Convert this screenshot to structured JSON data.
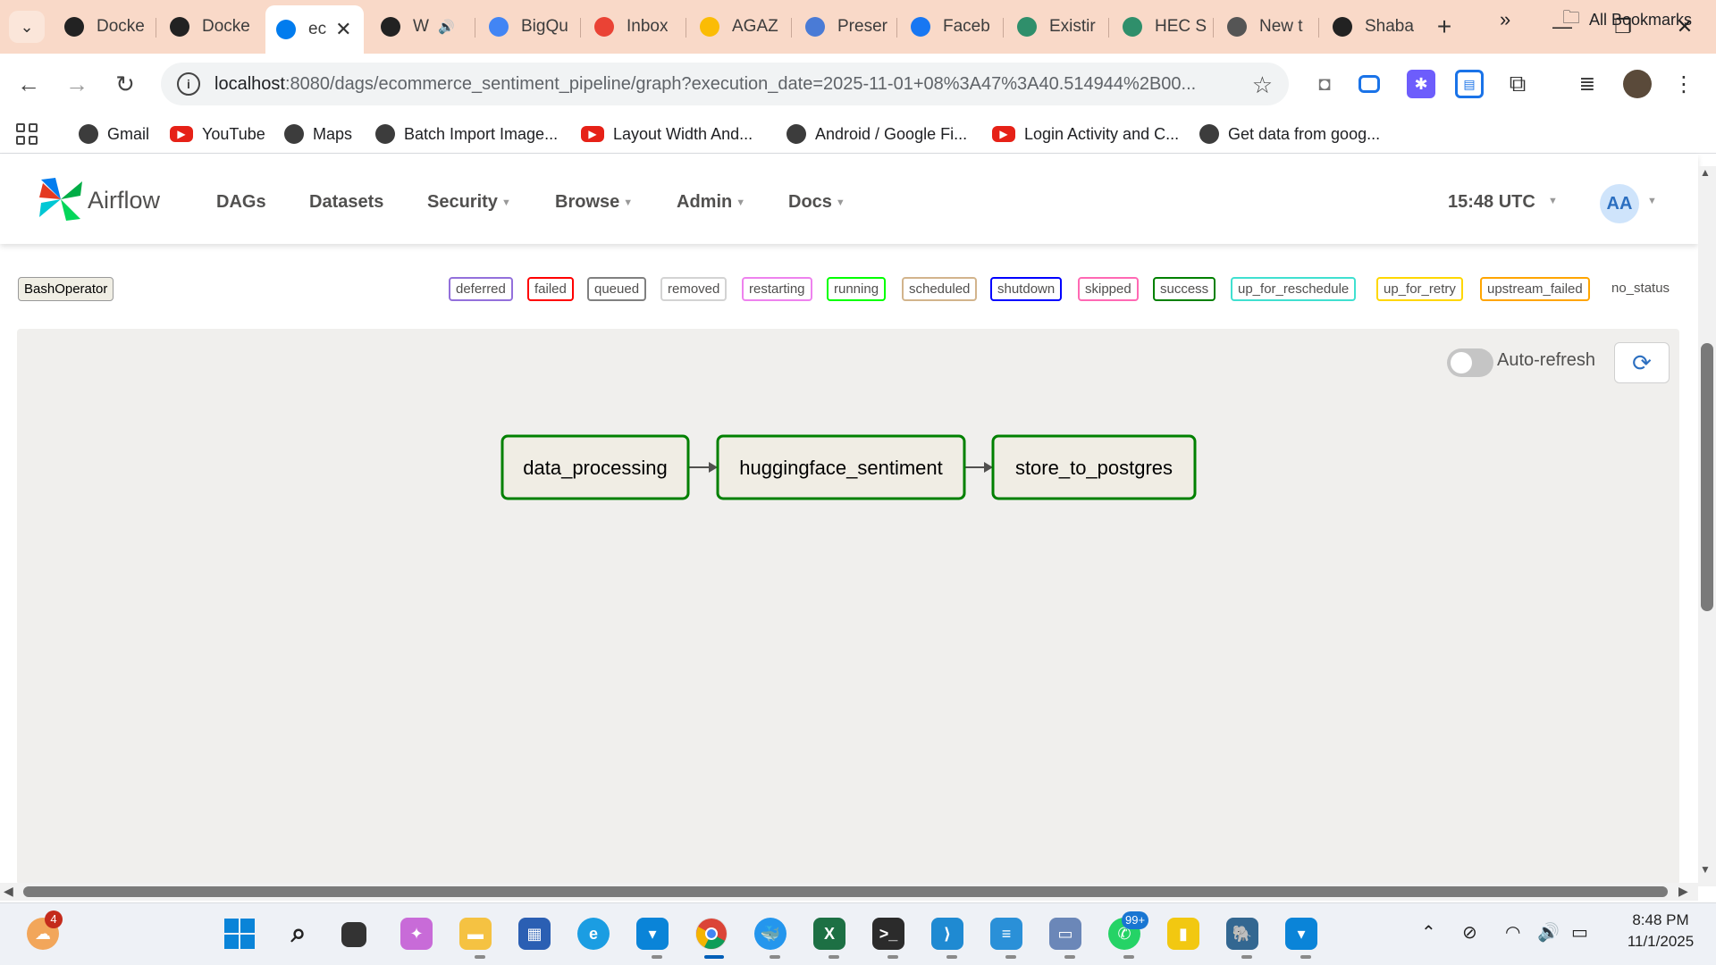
{
  "browser": {
    "tabs": [
      {
        "label": "Docke",
        "icon": "openai-icon",
        "color": "#222222",
        "active": false
      },
      {
        "label": "Docke",
        "icon": "openai-icon",
        "color": "#222222",
        "active": false
      },
      {
        "label": "ec",
        "icon": "airflow-icon",
        "color": "#017cee",
        "active": true,
        "close": "✕"
      },
      {
        "label": "W",
        "icon": "timer-icon",
        "color": "#222222",
        "active": false,
        "audio": "🔊"
      },
      {
        "label": "BigQu",
        "icon": "bigquery-icon",
        "color": "#4285f4",
        "active": false
      },
      {
        "label": "Inbox",
        "icon": "gmail-icon",
        "color": "#ea4335",
        "active": false
      },
      {
        "label": "AGAZ",
        "icon": "pinwheel-icon",
        "color": "#fbbc05",
        "active": false
      },
      {
        "label": "Preser",
        "icon": "slides-icon",
        "color": "#4a7bd6",
        "active": false
      },
      {
        "label": "Faceb",
        "icon": "facebook-icon",
        "color": "#1877f2",
        "active": false
      },
      {
        "label": "Existir",
        "icon": "seal-icon",
        "color": "#2f8f6b",
        "active": false
      },
      {
        "label": "HEC S",
        "icon": "seal-icon",
        "color": "#2f8f6b",
        "active": false
      },
      {
        "label": "New t",
        "icon": "chrome-icon",
        "color": "#555555",
        "active": false
      },
      {
        "label": "Shaba",
        "icon": "github-icon",
        "color": "#222222",
        "active": false
      }
    ],
    "new_tab": "+",
    "window_controls": {
      "minimize": "—",
      "restore": "❐",
      "close": "✕"
    },
    "url_host": "localhost",
    "url_rest": ":8080/dags/ecommerce_sentiment_pipeline/graph?execution_date=2025-11-01+08%3A47%3A40.514944%2B00...",
    "bookmarks": [
      {
        "label": "Gmail",
        "icon": "globe-icon"
      },
      {
        "label": "YouTube",
        "icon": "youtube-icon"
      },
      {
        "label": "Maps",
        "icon": "globe-icon"
      },
      {
        "label": "Batch Import Image...",
        "icon": "globe-icon"
      },
      {
        "label": "Layout Width And...",
        "icon": "youtube-icon"
      },
      {
        "label": "Android / Google Fi...",
        "icon": "globe-icon"
      },
      {
        "label": "Login Activity and C...",
        "icon": "youtube-icon"
      },
      {
        "label": "Get data from goog...",
        "icon": "globe-icon"
      }
    ],
    "bookmarks_overflow": "»",
    "all_bookmarks": "All Bookmarks"
  },
  "airflow": {
    "brand": "Airflow",
    "menu": [
      {
        "label": "DAGs",
        "dropdown": false
      },
      {
        "label": "Datasets",
        "dropdown": false
      },
      {
        "label": "Security",
        "dropdown": true
      },
      {
        "label": "Browse",
        "dropdown": true
      },
      {
        "label": "Admin",
        "dropdown": true
      },
      {
        "label": "Docs",
        "dropdown": true
      }
    ],
    "clock": "15:48 UTC",
    "avatar": "AA"
  },
  "legend": {
    "operator": "BashOperator",
    "statuses": [
      {
        "label": "deferred",
        "color": "#9370db"
      },
      {
        "label": "failed",
        "color": "#ff0000"
      },
      {
        "label": "queued",
        "color": "#808080"
      },
      {
        "label": "removed",
        "color": "#d3d3d3"
      },
      {
        "label": "restarting",
        "color": "#ee82ee"
      },
      {
        "label": "running",
        "color": "#00ff00"
      },
      {
        "label": "scheduled",
        "color": "#d2b48c"
      },
      {
        "label": "shutdown",
        "color": "#0000ff"
      },
      {
        "label": "skipped",
        "color": "#ff69b4"
      },
      {
        "label": "success",
        "color": "#008000"
      },
      {
        "label": "up_for_reschedule",
        "color": "#40e0d0"
      },
      {
        "label": "up_for_retry",
        "color": "#ffd700"
      },
      {
        "label": "upstream_failed",
        "color": "#ffa500"
      }
    ],
    "no_status": "no_status"
  },
  "graph": {
    "auto_refresh_label": "Auto-refresh",
    "auto_refresh_on": false,
    "refresh_icon": "⟳",
    "tasks": [
      {
        "id": "data_processing",
        "state": "success"
      },
      {
        "id": "huggingface_sentiment",
        "state": "success"
      },
      {
        "id": "store_to_postgres",
        "state": "success"
      }
    ]
  },
  "taskbar": {
    "weather_badge": "4",
    "whatsapp_badge": "99+",
    "time": "8:48 PM",
    "date": "11/1/2025"
  }
}
